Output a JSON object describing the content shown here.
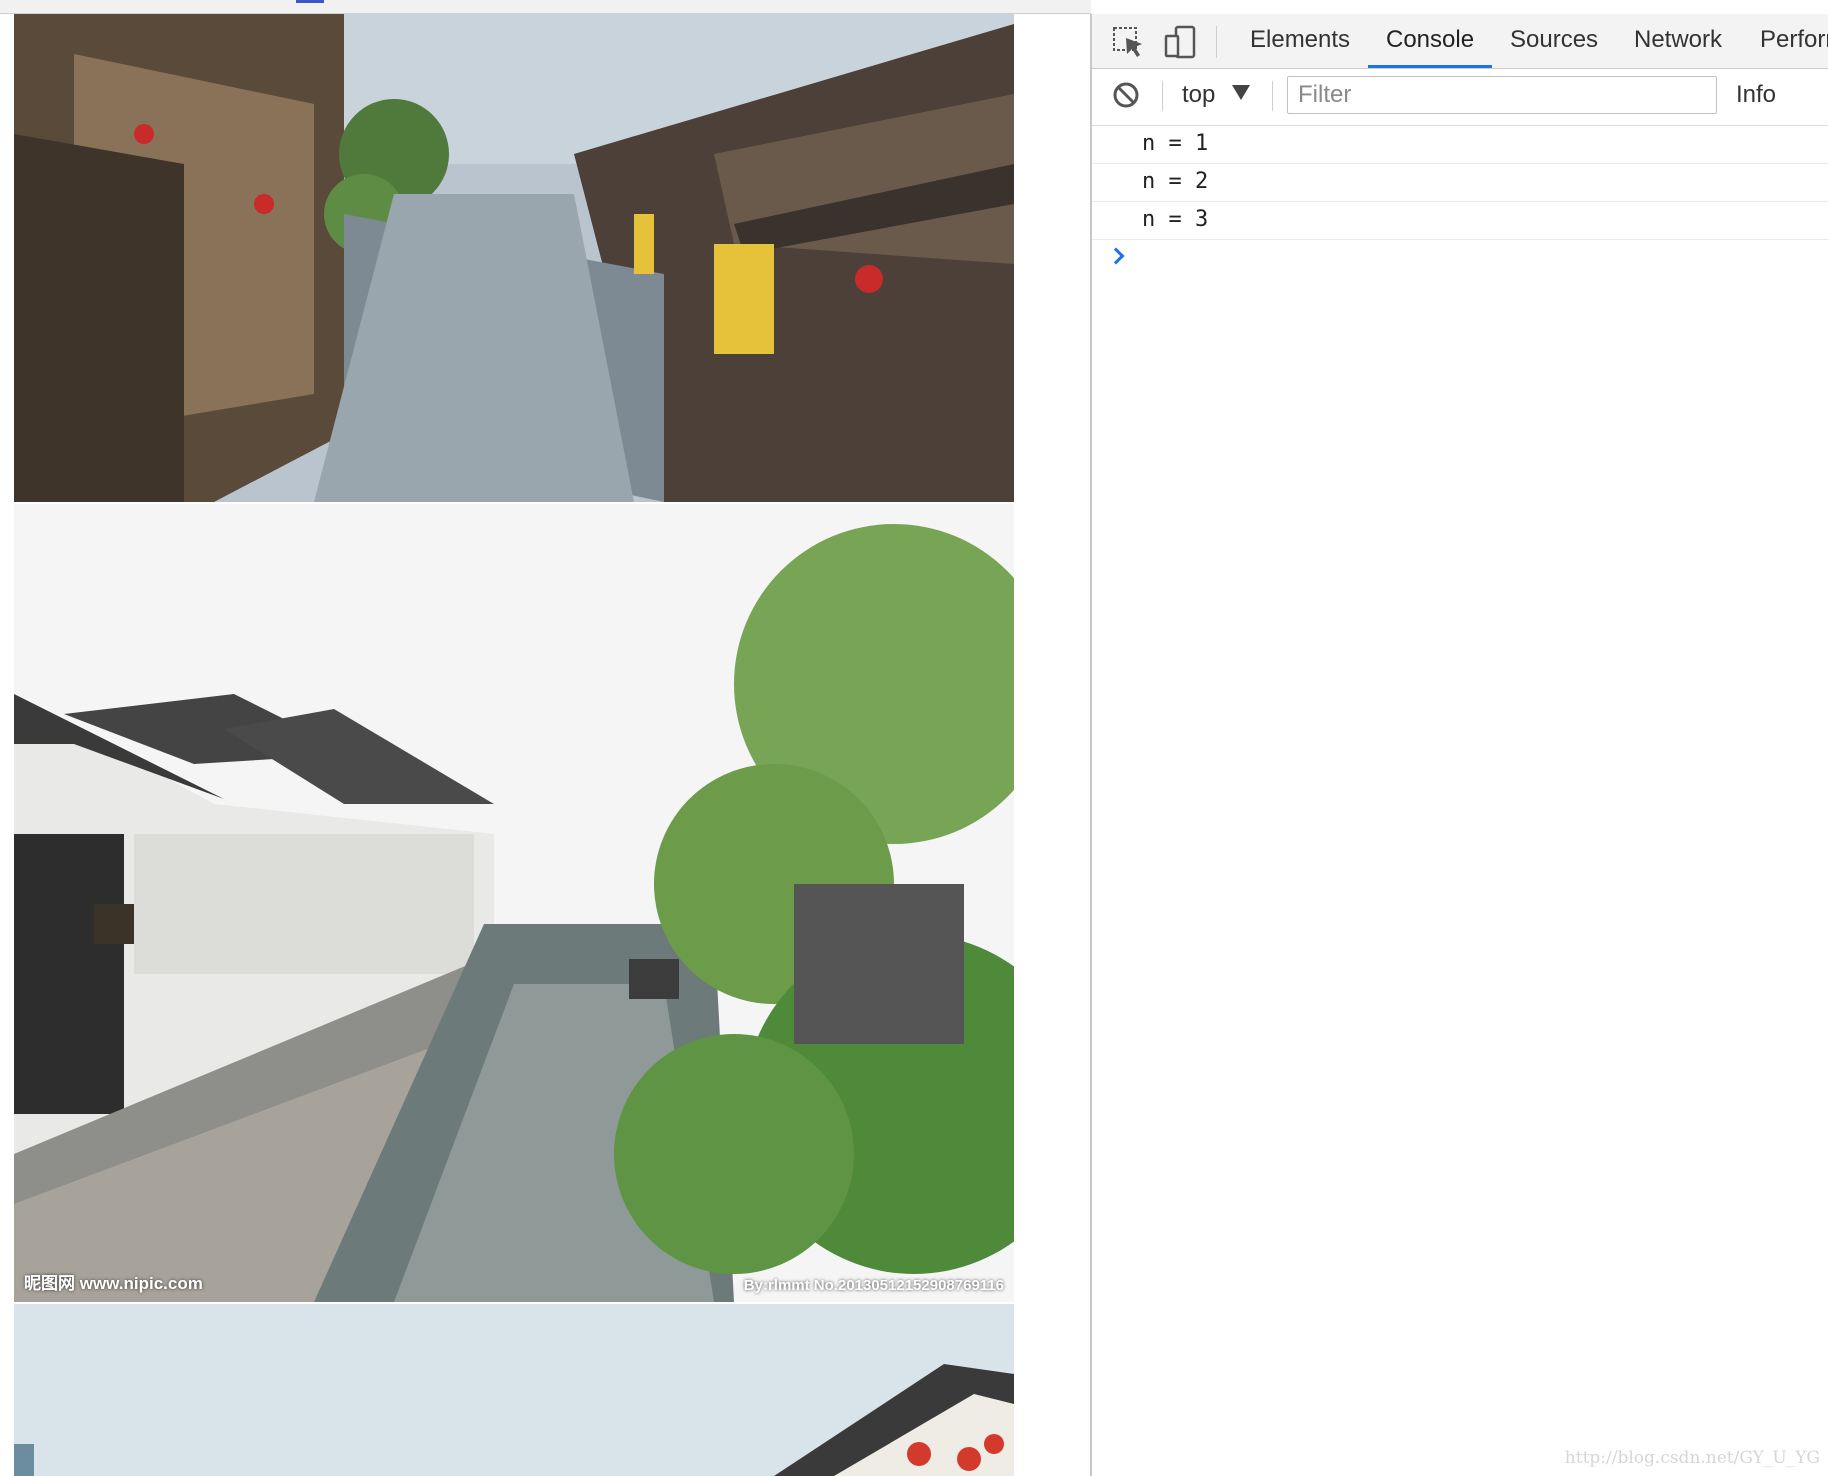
{
  "page": {
    "watermark_left": "昵图网 www.nipic.com",
    "watermark_right": "By:rlmmt No.20130512152908769116"
  },
  "devtools": {
    "tabs": [
      {
        "label": "Elements"
      },
      {
        "label": "Console"
      },
      {
        "label": "Sources"
      },
      {
        "label": "Network"
      },
      {
        "label": "Perforr"
      }
    ],
    "active_tab": "Console",
    "context": "top",
    "filter_placeholder": "Filter",
    "level": "Info",
    "logs": [
      "n = 1",
      "n = 2",
      "n = 3"
    ]
  },
  "footer": {
    "watermark": "http://blog.csdn.net/GY_U_YG"
  },
  "colors": {
    "accent": "#1a73e8",
    "clear_icon": "#555555"
  },
  "icons": [
    "inspect-element-icon",
    "device-toolbar-icon",
    "clear-console-icon",
    "dropdown-arrow-icon",
    "console-prompt-icon"
  ]
}
